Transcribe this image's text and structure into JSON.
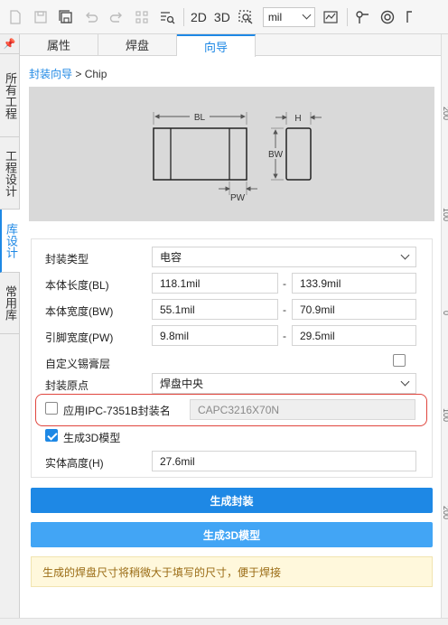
{
  "toolbar": {
    "btn_2d": "2D",
    "btn_3d": "3D",
    "unit": "mil"
  },
  "vertical_tabs": [
    {
      "label": "所有工程"
    },
    {
      "label": "工程设计"
    },
    {
      "label": "库设计"
    },
    {
      "label": "常用库"
    }
  ],
  "tabs": [
    {
      "label": "属性"
    },
    {
      "label": "焊盘"
    },
    {
      "label": "向导"
    }
  ],
  "breadcrumb": {
    "root": "封装向导",
    "separator": " > ",
    "current": "Chip"
  },
  "diagram": {
    "label_bl": "BL",
    "label_h": "H",
    "label_bw": "BW",
    "label_pw": "PW"
  },
  "form": {
    "package_type_label": "封装类型",
    "package_type_value": "电容",
    "bl_label": "本体长度(BL)",
    "bl_min": "118.1mil",
    "bl_max": "133.9mil",
    "bw_label": "本体宽度(BW)",
    "bw_min": "55.1mil",
    "bw_max": "70.9mil",
    "pw_label": "引脚宽度(PW)",
    "pw_min": "9.8mil",
    "pw_max": "29.5mil",
    "range_sep": "-",
    "custom_paste_label": "自定义锡膏层",
    "origin_label": "封装原点",
    "origin_value": "焊盘中央",
    "ipc_label": "应用IPC-7351B封装名",
    "ipc_name": "CAPC3216X70N",
    "gen3d_label": "生成3D模型",
    "height_label": "实体高度(H)",
    "height_value": "27.6mil"
  },
  "buttons": {
    "generate_package": "生成封装",
    "generate_3d": "生成3D模型"
  },
  "notice": "生成的焊盘尺寸将稍微大于填写的尺寸，便于焊接",
  "ruler": [
    "200",
    "100",
    "0",
    "100",
    "200"
  ],
  "colors": {
    "accent": "#1e88e5",
    "highlight_border": "#e0463e",
    "notice_bg": "#fff8dc"
  }
}
